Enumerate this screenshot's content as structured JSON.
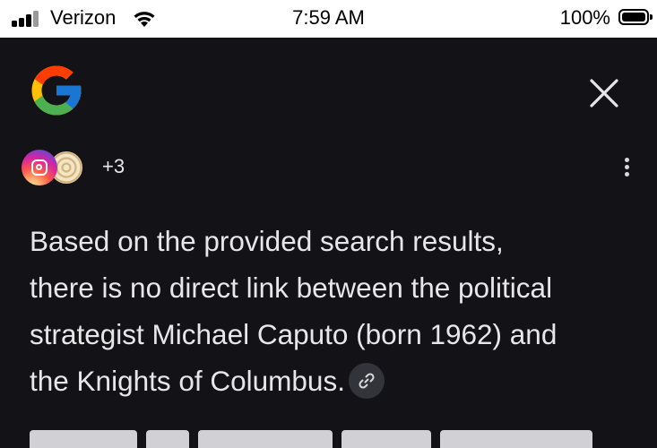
{
  "status_bar": {
    "carrier": "Verizon",
    "time": "7:59 AM",
    "battery": "100%"
  },
  "header": {
    "logo": "google-g-logo",
    "close_icon": "close-icon"
  },
  "sources": {
    "icons": [
      "instagram-icon",
      "wood-rings-icon"
    ],
    "extra_count": "+3",
    "more_icon": "more-vertical-icon"
  },
  "answer": {
    "lines": [
      "Based on the provided search results,",
      "there is no direct link between the political",
      "strategist Michael Caputo (born 1962) and",
      "the Knights of Columbus."
    ],
    "link_icon": "link-icon"
  },
  "colors": {
    "background": "#121217",
    "text": "#e7e7ea",
    "status_bar": "#ffffff",
    "chip": "#33343a"
  }
}
